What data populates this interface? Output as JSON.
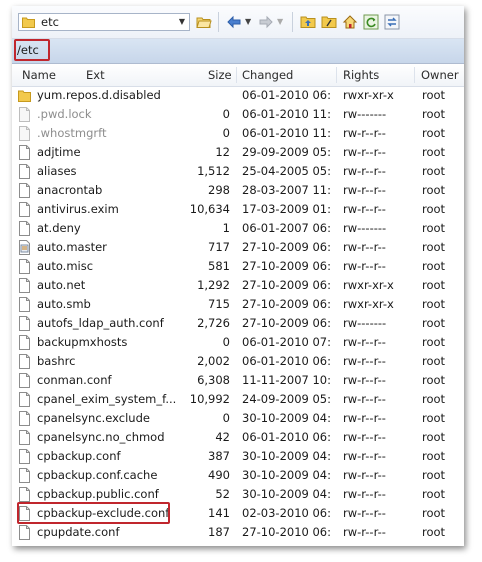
{
  "toolbar": {
    "path": "etc",
    "icons": [
      "folder-icon",
      "open-folder-icon",
      "back-arrow-icon",
      "forward-arrow-icon",
      "parent-dir-icon",
      "root-dir-icon",
      "home-icon",
      "refresh-icon",
      "sync-icon"
    ]
  },
  "address": {
    "path": "/etc"
  },
  "columns": {
    "name": "Name",
    "ext": "Ext",
    "size": "Size",
    "changed": "Changed",
    "rights": "Rights",
    "owner": "Owner"
  },
  "files": [
    {
      "name": "yum.repos.d.disabled",
      "size": "",
      "changed": "06-01-2010 06:...",
      "rights": "rwxr-xr-x",
      "owner": "root",
      "type": "folder"
    },
    {
      "name": ".pwd.lock",
      "size": "0",
      "changed": "06-01-2010 11:...",
      "rights": "rw-------",
      "owner": "root",
      "type": "hidden"
    },
    {
      "name": ".whostmgrft",
      "size": "0",
      "changed": "06-01-2010 11:...",
      "rights": "rw-r--r--",
      "owner": "root",
      "type": "hidden"
    },
    {
      "name": "adjtime",
      "size": "12",
      "changed": "29-09-2009 05:...",
      "rights": "rw-r--r--",
      "owner": "root",
      "type": "file"
    },
    {
      "name": "aliases",
      "size": "1,512",
      "changed": "25-04-2005 05:...",
      "rights": "rw-r--r--",
      "owner": "root",
      "type": "file"
    },
    {
      "name": "anacrontab",
      "size": "298",
      "changed": "28-03-2007 11:...",
      "rights": "rw-r--r--",
      "owner": "root",
      "type": "file"
    },
    {
      "name": "antivirus.exim",
      "size": "10,634",
      "changed": "17-03-2009 01:...",
      "rights": "rw-r--r--",
      "owner": "root",
      "type": "file"
    },
    {
      "name": "at.deny",
      "size": "1",
      "changed": "06-01-2007 06:...",
      "rights": "rw-------",
      "owner": "root",
      "type": "file"
    },
    {
      "name": "auto.master",
      "size": "717",
      "changed": "27-10-2009 06:...",
      "rights": "rw-r--r--",
      "owner": "root",
      "type": "config"
    },
    {
      "name": "auto.misc",
      "size": "581",
      "changed": "27-10-2009 06:...",
      "rights": "rw-r--r--",
      "owner": "root",
      "type": "file"
    },
    {
      "name": "auto.net",
      "size": "1,292",
      "changed": "27-10-2009 06:...",
      "rights": "rwxr-xr-x",
      "owner": "root",
      "type": "file"
    },
    {
      "name": "auto.smb",
      "size": "715",
      "changed": "27-10-2009 06:...",
      "rights": "rwxr-xr-x",
      "owner": "root",
      "type": "file"
    },
    {
      "name": "autofs_ldap_auth.conf",
      "size": "2,726",
      "changed": "27-10-2009 06:...",
      "rights": "rw-------",
      "owner": "root",
      "type": "file"
    },
    {
      "name": "backupmxhosts",
      "size": "0",
      "changed": "06-01-2010 07:...",
      "rights": "rw-r--r--",
      "owner": "root",
      "type": "file"
    },
    {
      "name": "bashrc",
      "size": "2,002",
      "changed": "06-01-2010 06:...",
      "rights": "rw-r--r--",
      "owner": "root",
      "type": "file"
    },
    {
      "name": "conman.conf",
      "size": "6,308",
      "changed": "11-11-2007 10:...",
      "rights": "rw-r--r--",
      "owner": "root",
      "type": "file"
    },
    {
      "name": "cpanel_exim_system_f...",
      "size": "10,992",
      "changed": "24-09-2009 05:...",
      "rights": "rw-r--r--",
      "owner": "root",
      "type": "file"
    },
    {
      "name": "cpanelsync.exclude",
      "size": "0",
      "changed": "30-10-2009 04:...",
      "rights": "rw-r--r--",
      "owner": "root",
      "type": "file"
    },
    {
      "name": "cpanelsync.no_chmod",
      "size": "42",
      "changed": "06-01-2010 06:...",
      "rights": "rw-r--r--",
      "owner": "root",
      "type": "file"
    },
    {
      "name": "cpbackup.conf",
      "size": "387",
      "changed": "30-10-2009 04:...",
      "rights": "rw-r--r--",
      "owner": "root",
      "type": "file"
    },
    {
      "name": "cpbackup.conf.cache",
      "size": "490",
      "changed": "30-10-2009 04:...",
      "rights": "rw-r--r--",
      "owner": "root",
      "type": "file"
    },
    {
      "name": "cpbackup.public.conf",
      "size": "52",
      "changed": "30-10-2009 04:...",
      "rights": "rw-r--r--",
      "owner": "root",
      "type": "file"
    },
    {
      "name": "cpbackup-exclude.conf",
      "size": "141",
      "changed": "02-03-2010 06:...",
      "rights": "rw-r--r--",
      "owner": "root",
      "type": "file"
    },
    {
      "name": "cpupdate.conf",
      "size": "187",
      "changed": "27-10-2010 06:...",
      "rights": "rw-r--r--",
      "owner": "root",
      "type": "file"
    }
  ],
  "colors": {
    "highlight": "#c0262d",
    "address_bar": "#c7d6ea",
    "folder": "#f2c94c"
  }
}
